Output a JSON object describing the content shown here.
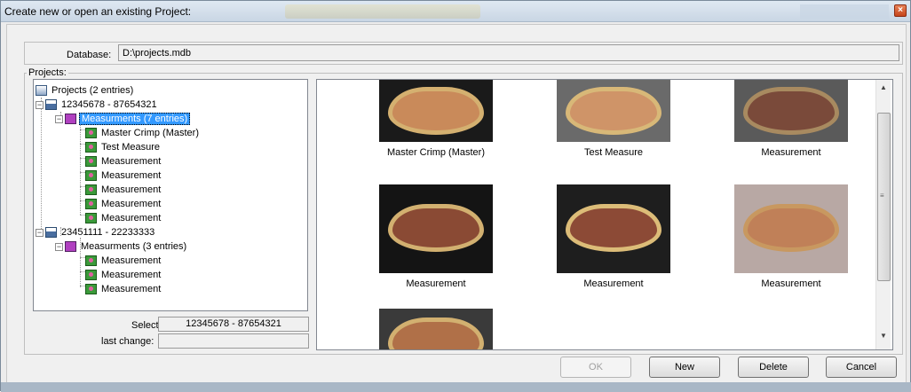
{
  "window": {
    "title": "Create new or open an existing Project:",
    "close_glyph": "×"
  },
  "database": {
    "label": "Database:",
    "value": "D:\\projects.mdb"
  },
  "projects": {
    "legend": "Projects:"
  },
  "tree": {
    "root": "Projects (2 entries)",
    "project1": "12345678 - 87654321",
    "measurements1": "Measurments (7 entries)",
    "items1": [
      "Master Crimp (Master)",
      "Test Measure",
      "Measurement",
      "Measurement",
      "Measurement",
      "Measurement",
      "Measurement"
    ],
    "project2": "23451111 - 22233333",
    "measurements2": "Measurments (3 entries)",
    "items2": [
      "Measurement",
      "Measurement",
      "Measurement"
    ]
  },
  "selection": {
    "selected_label": "Selected:",
    "selected_value": "12345678 - 87654321",
    "last_change_label": "last change:",
    "last_change_value": ""
  },
  "thumbnails": [
    "Master Crimp (Master)",
    "Test Measure",
    "Measurement",
    "Measurement",
    "Measurement",
    "Measurement",
    ""
  ],
  "buttons": {
    "ok": "OK",
    "new": "New",
    "delete": "Delete",
    "cancel": "Cancel"
  },
  "scrollbar": {
    "up": "▲",
    "grip": "≡",
    "down": "▼"
  },
  "tree_expander": "−"
}
